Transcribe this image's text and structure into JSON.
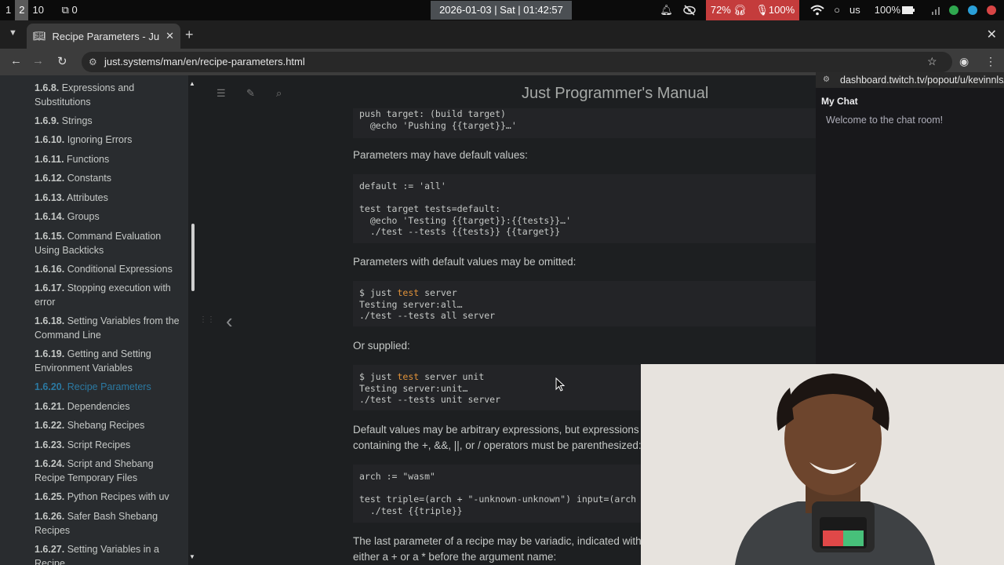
{
  "system_bar": {
    "workspaces": [
      "1",
      "2",
      "10"
    ],
    "active_workspace": "2",
    "window_count": "0",
    "clock": "2026-01-03 | Sat | 01:42:57",
    "battery_headphones": "72%",
    "mic": "100%",
    "keyboard_layout": "us",
    "battery": "100%"
  },
  "browser": {
    "tab_title": "Recipe Parameters - Ju",
    "url": "just.systems/man/en/recipe-parameters.html"
  },
  "book": {
    "title": "Just Programmer's Manual"
  },
  "sidebar": {
    "items": [
      {
        "num": "1.6.8.",
        "label": "Expressions and Substitutions"
      },
      {
        "num": "1.6.9.",
        "label": "Strings"
      },
      {
        "num": "1.6.10.",
        "label": "Ignoring Errors"
      },
      {
        "num": "1.6.11.",
        "label": "Functions"
      },
      {
        "num": "1.6.12.",
        "label": "Constants"
      },
      {
        "num": "1.6.13.",
        "label": "Attributes"
      },
      {
        "num": "1.6.14.",
        "label": "Groups"
      },
      {
        "num": "1.6.15.",
        "label": "Command Evaluation Using Backticks"
      },
      {
        "num": "1.6.16.",
        "label": "Conditional Expressions"
      },
      {
        "num": "1.6.17.",
        "label": "Stopping execution with error"
      },
      {
        "num": "1.6.18.",
        "label": "Setting Variables from the Command Line"
      },
      {
        "num": "1.6.19.",
        "label": "Getting and Setting Environment Variables"
      },
      {
        "num": "1.6.20.",
        "label": "Recipe Parameters"
      },
      {
        "num": "1.6.21.",
        "label": "Dependencies"
      },
      {
        "num": "1.6.22.",
        "label": "Shebang Recipes"
      },
      {
        "num": "1.6.23.",
        "label": "Script Recipes"
      },
      {
        "num": "1.6.24.",
        "label": "Script and Shebang Recipe Temporary Files"
      },
      {
        "num": "1.6.25.",
        "label": "Python Recipes with uv"
      },
      {
        "num": "1.6.26.",
        "label": "Safer Bash Shebang Recipes"
      },
      {
        "num": "1.6.27.",
        "label": "Setting Variables in a Recipe"
      }
    ],
    "active_index": 12
  },
  "content": {
    "code1": [
      "push target: (build target)",
      "  @echo 'Pushing {{target}}…'"
    ],
    "p1": "Parameters may have default values:",
    "code2": [
      "default := 'all'",
      "",
      "test target tests=default:",
      "  @echo 'Testing {{target}}:{{tests}}…'",
      "  ./test --tests {{tests}} {{target}}"
    ],
    "p2": "Parameters with default values may be omitted:",
    "code3": [
      "$ just test server",
      "Testing server:all…",
      "./test --tests all server"
    ],
    "p3": "Or supplied:",
    "code4": [
      "$ just test server unit",
      "Testing server:unit…",
      "./test --tests unit server"
    ],
    "p4": "Default values may be arbitrary expressions, but expressions containing the +, &&, ||, or / operators must be parenthesized:",
    "code5": [
      "arch := \"wasm\"",
      "",
      "test triple=(arch + \"-unknown-unknown\") input=(arch + \".md\"):",
      "  ./test {{triple}}"
    ],
    "p5": "The last parameter of a recipe may be variadic, indicated with either a + or a * before the argument name:"
  },
  "chat": {
    "url": "dashboard.twitch.tv/popout/u/kevinnls/chat",
    "title": "My Chat",
    "welcome": "Welcome to the chat room!"
  },
  "colors": {
    "sidebar_bg": "#292c2f",
    "content_bg": "#1d1f21",
    "active_link": "#2b79a2",
    "code_bg": "#232427",
    "keyword": "#e0923a",
    "alert_red": "#c43c3c"
  }
}
